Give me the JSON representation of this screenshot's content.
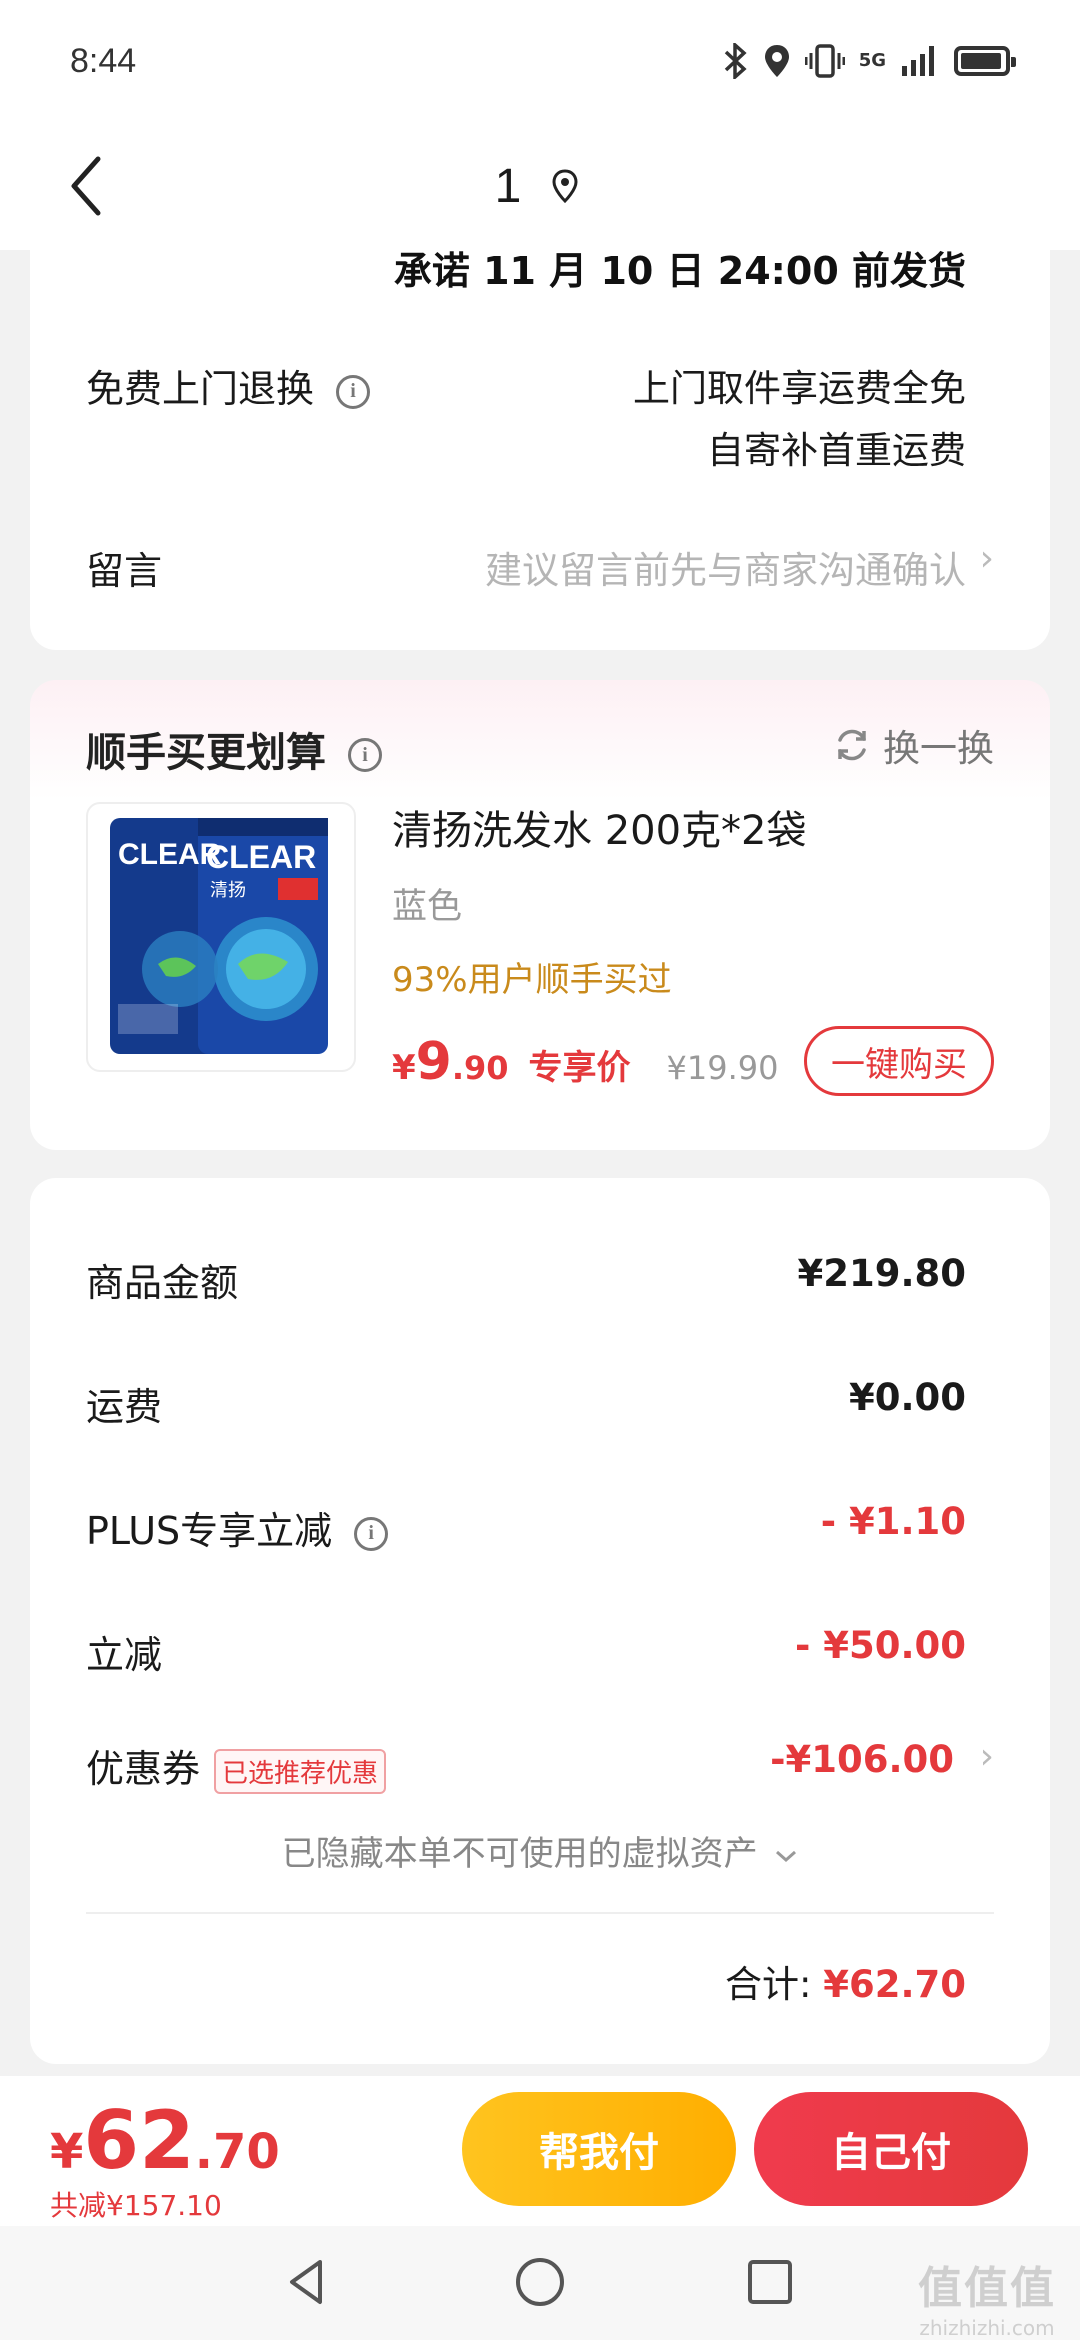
{
  "status_bar": {
    "time": "8:44",
    "network": "5G",
    "icons": [
      "bluetooth-icon",
      "location-icon",
      "vibrate-icon",
      "signal-icon",
      "battery-icon"
    ]
  },
  "nav": {
    "title": "1",
    "back_icon": "chevron-left-icon",
    "location_icon": "location-pin-icon"
  },
  "delivery": {
    "promise": "承诺 11 月 10 日 24:00 前发货",
    "return_label": "免费上门退换",
    "return_line1": "上门取件享运费全免",
    "return_line2": "自寄补首重运费",
    "message_label": "留言",
    "message_placeholder": "建议留言前先与商家沟通确认",
    "chevron": "›"
  },
  "upsell": {
    "title": "顺手买更划算",
    "swap_label": "换一换",
    "product": {
      "name": "清扬洗发水 200克*2袋",
      "variant": "蓝色",
      "stat": "93%用户顺手买过",
      "currency": "¥",
      "price_int": "9",
      "price_dec": ".90",
      "price_label": "专享价",
      "original_price": "¥19.90",
      "buy_button": "一键购买",
      "brand_text": "CLEAR",
      "brand_cn": "清扬"
    }
  },
  "summary": {
    "rows": [
      {
        "label": "商品金额",
        "value": "¥219.80"
      },
      {
        "label": "运费",
        "value": "¥0.00"
      },
      {
        "label": "PLUS专享立减",
        "value": "- ¥1.10"
      },
      {
        "label": "立减",
        "value": "- ¥50.00"
      },
      {
        "label": "优惠券",
        "value": "-¥106.00"
      }
    ],
    "coupon_tag": "已选推荐优惠",
    "hidden_note": "已隐藏本单不可使用的虚拟资产",
    "total_label": "合计:",
    "total_value": "¥62.70"
  },
  "bottom_bar": {
    "currency": "¥",
    "price_int": "62",
    "price_dec": ".70",
    "saved": "共减¥157.10",
    "help_pay": "帮我付",
    "self_pay": "自己付"
  },
  "watermark": {
    "line1": "值值值",
    "line2": "zhizhizhi.com"
  },
  "colors": {
    "accent_red": "#e4393c",
    "accent_yellow": "#ffb800",
    "stat_orange": "#c98a1b"
  }
}
